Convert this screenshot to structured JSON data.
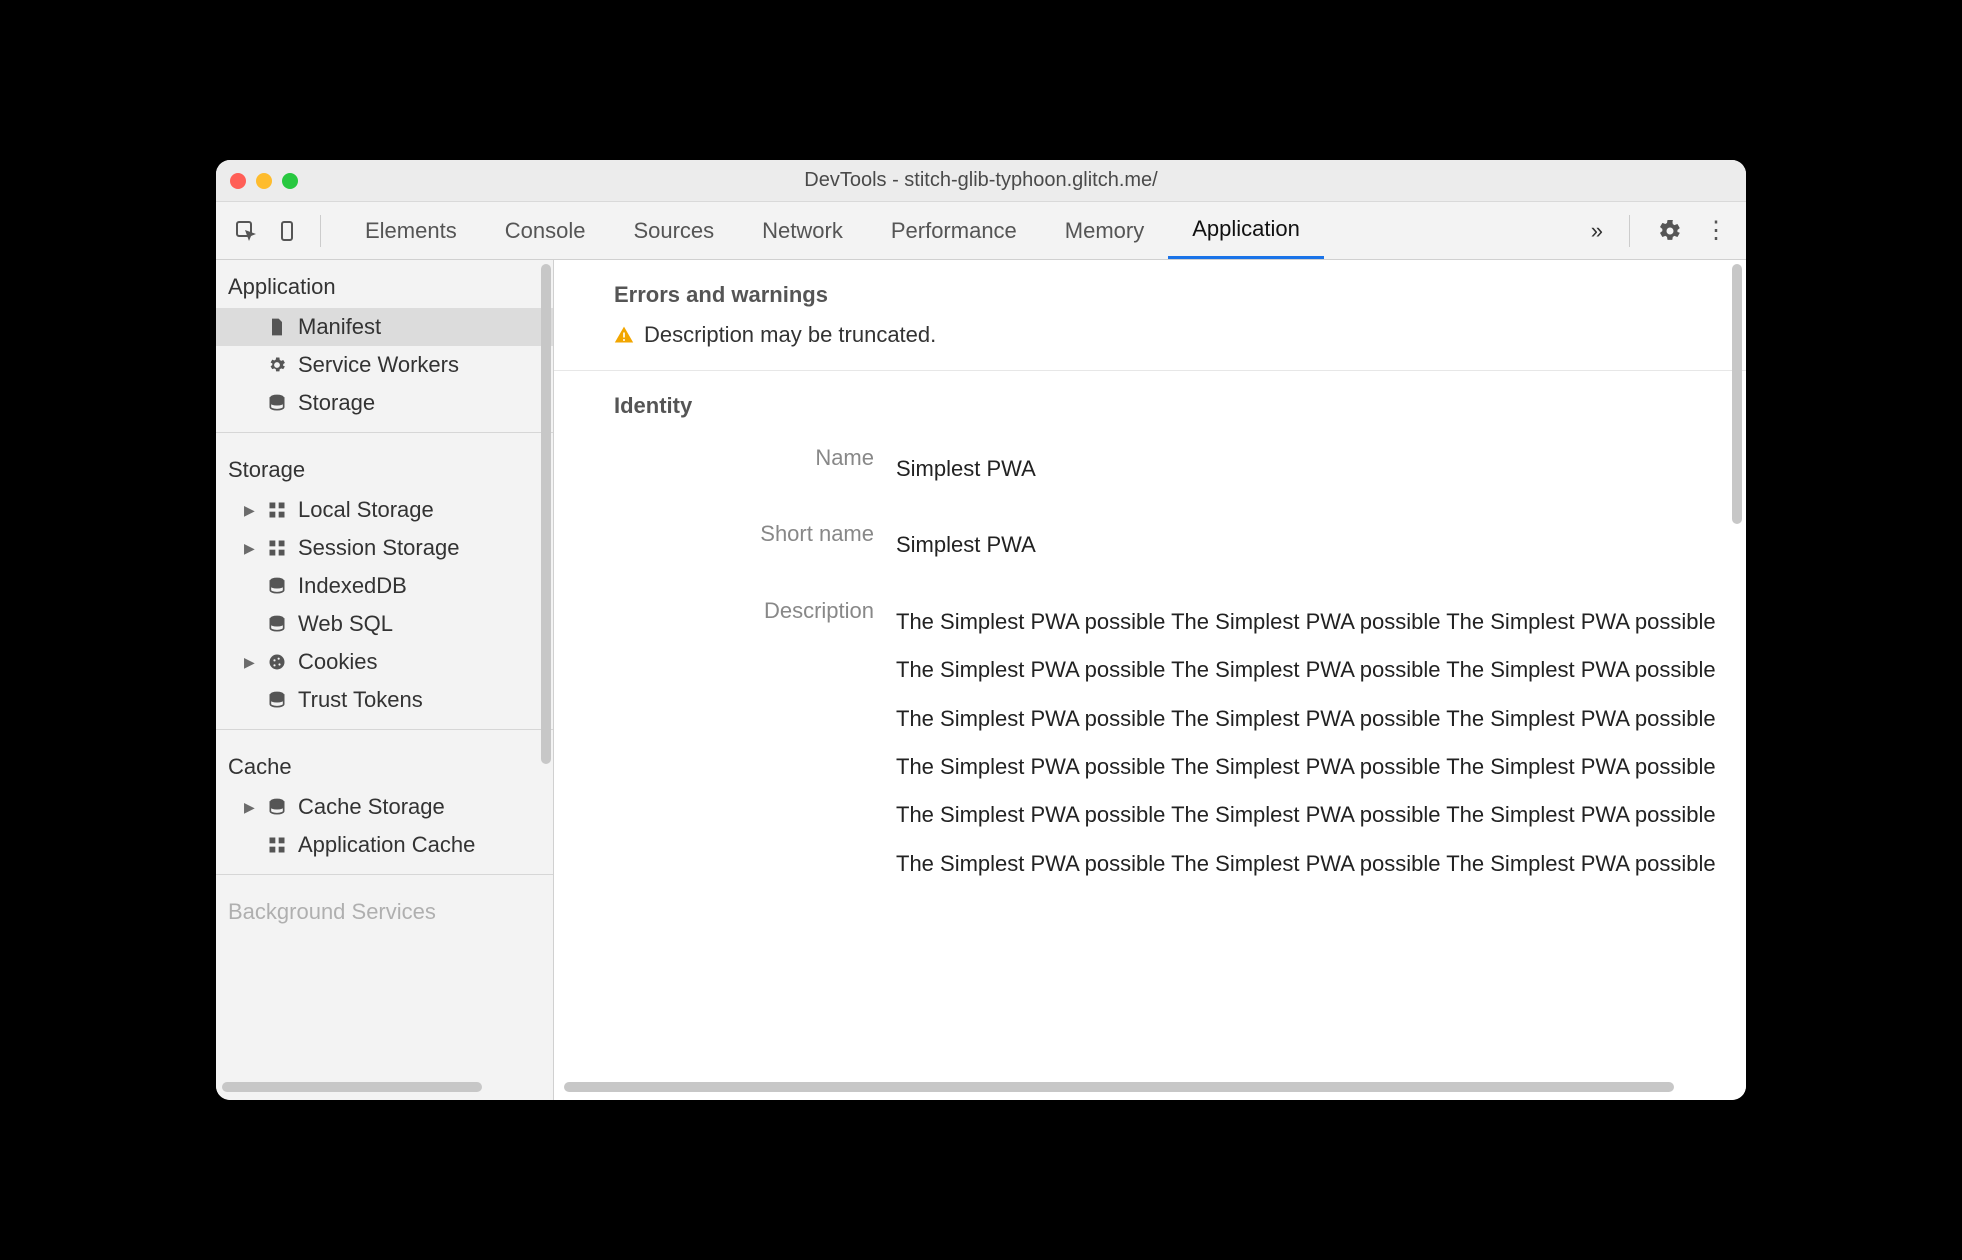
{
  "window": {
    "title": "DevTools - stitch-glib-typhoon.glitch.me/"
  },
  "toolbar": {
    "tabs": [
      "Elements",
      "Console",
      "Sources",
      "Network",
      "Performance",
      "Memory",
      "Application"
    ],
    "active_tab": "Application",
    "overflow_glyph": "»"
  },
  "sidebar": {
    "sections": [
      {
        "title": "Application",
        "items": [
          {
            "icon": "file-icon",
            "label": "Manifest",
            "selected": true,
            "expandable": false
          },
          {
            "icon": "gear-icon",
            "label": "Service Workers",
            "selected": false,
            "expandable": false
          },
          {
            "icon": "database-icon",
            "label": "Storage",
            "selected": false,
            "expandable": false
          }
        ]
      },
      {
        "title": "Storage",
        "items": [
          {
            "icon": "grid-icon",
            "label": "Local Storage",
            "selected": false,
            "expandable": true
          },
          {
            "icon": "grid-icon",
            "label": "Session Storage",
            "selected": false,
            "expandable": true
          },
          {
            "icon": "database-icon",
            "label": "IndexedDB",
            "selected": false,
            "expandable": false
          },
          {
            "icon": "database-icon",
            "label": "Web SQL",
            "selected": false,
            "expandable": false
          },
          {
            "icon": "cookie-icon",
            "label": "Cookies",
            "selected": false,
            "expandable": true
          },
          {
            "icon": "database-icon",
            "label": "Trust Tokens",
            "selected": false,
            "expandable": false
          }
        ]
      },
      {
        "title": "Cache",
        "items": [
          {
            "icon": "database-icon",
            "label": "Cache Storage",
            "selected": false,
            "expandable": true
          },
          {
            "icon": "grid-icon",
            "label": "Application Cache",
            "selected": false,
            "expandable": false
          }
        ]
      },
      {
        "title": "Background Services",
        "items": []
      }
    ]
  },
  "main": {
    "errors_section_title": "Errors and warnings",
    "warning_text": "Description may be truncated.",
    "identity_section_title": "Identity",
    "fields": {
      "name_label": "Name",
      "name_value": "Simplest PWA",
      "short_name_label": "Short name",
      "short_name_value": "Simplest PWA",
      "description_label": "Description",
      "description_value": "The Simplest PWA possible The Simplest PWA possible The Simplest PWA possible The Simplest PWA possible The Simplest PWA possible The Simplest PWA possible The Simplest PWA possible The Simplest PWA possible The Simplest PWA possible The Simplest PWA possible The Simplest PWA possible The Simplest PWA possible The Simplest PWA possible The Simplest PWA possible The Simplest PWA possible The Simplest PWA possible The Simplest PWA possible The Simplest PWA possible"
    }
  }
}
